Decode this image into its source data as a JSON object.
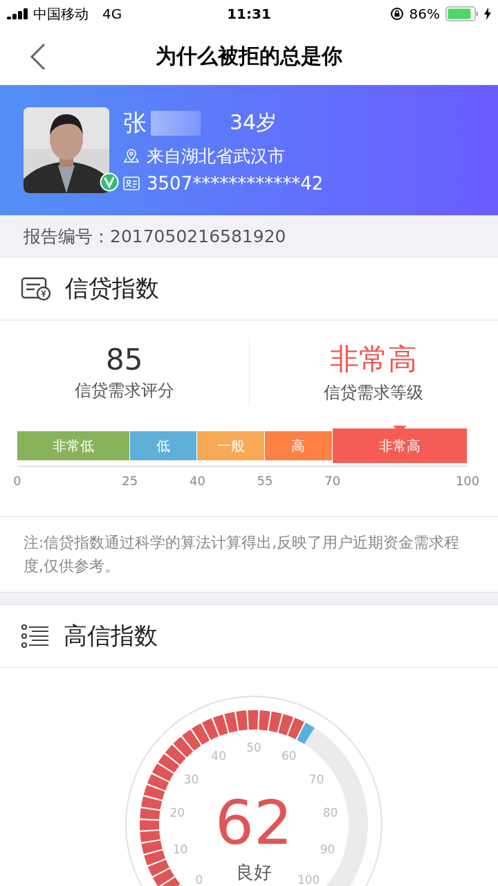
{
  "status_bar": {
    "carrier": "中国移动",
    "network": "4G",
    "time": "11:31",
    "battery": "86%"
  },
  "nav": {
    "title": "为什么被拒的总是你"
  },
  "profile": {
    "name": "张",
    "age": "34岁",
    "location": "来自湖北省武汉市",
    "id_number": "3507************42",
    "verified": true
  },
  "report": {
    "text": "报告编号：2017050216581920"
  },
  "credit_index": {
    "title": "信贷指数",
    "score": "85",
    "score_label": "信贷需求评分",
    "grade": "非常高",
    "grade_label": "信贷需求等级",
    "scale": {
      "ticks": [
        "0",
        "25",
        "40",
        "55",
        "70",
        "100"
      ],
      "segments": [
        {
          "label": "非常低",
          "color": "#88b35a",
          "selected": false
        },
        {
          "label": "低",
          "color": "#5fb0d8",
          "selected": false
        },
        {
          "label": "一般",
          "color": "#f8a956",
          "selected": false
        },
        {
          "label": "高",
          "color": "#fd8142",
          "selected": false
        },
        {
          "label": "非常高",
          "color": "#f55c55",
          "selected": true
        }
      ]
    },
    "note": "注:信贷指数通过科学的算法计算得出,反映了用户近期资金需求程度,仅供参考。"
  },
  "high_credit_index": {
    "title": "高信指数",
    "gauge": {
      "value": "62",
      "rating": "良好",
      "ticks": [
        "0",
        "10",
        "20",
        "30",
        "40",
        "50",
        "60",
        "70",
        "80",
        "90",
        "100"
      ]
    }
  }
}
